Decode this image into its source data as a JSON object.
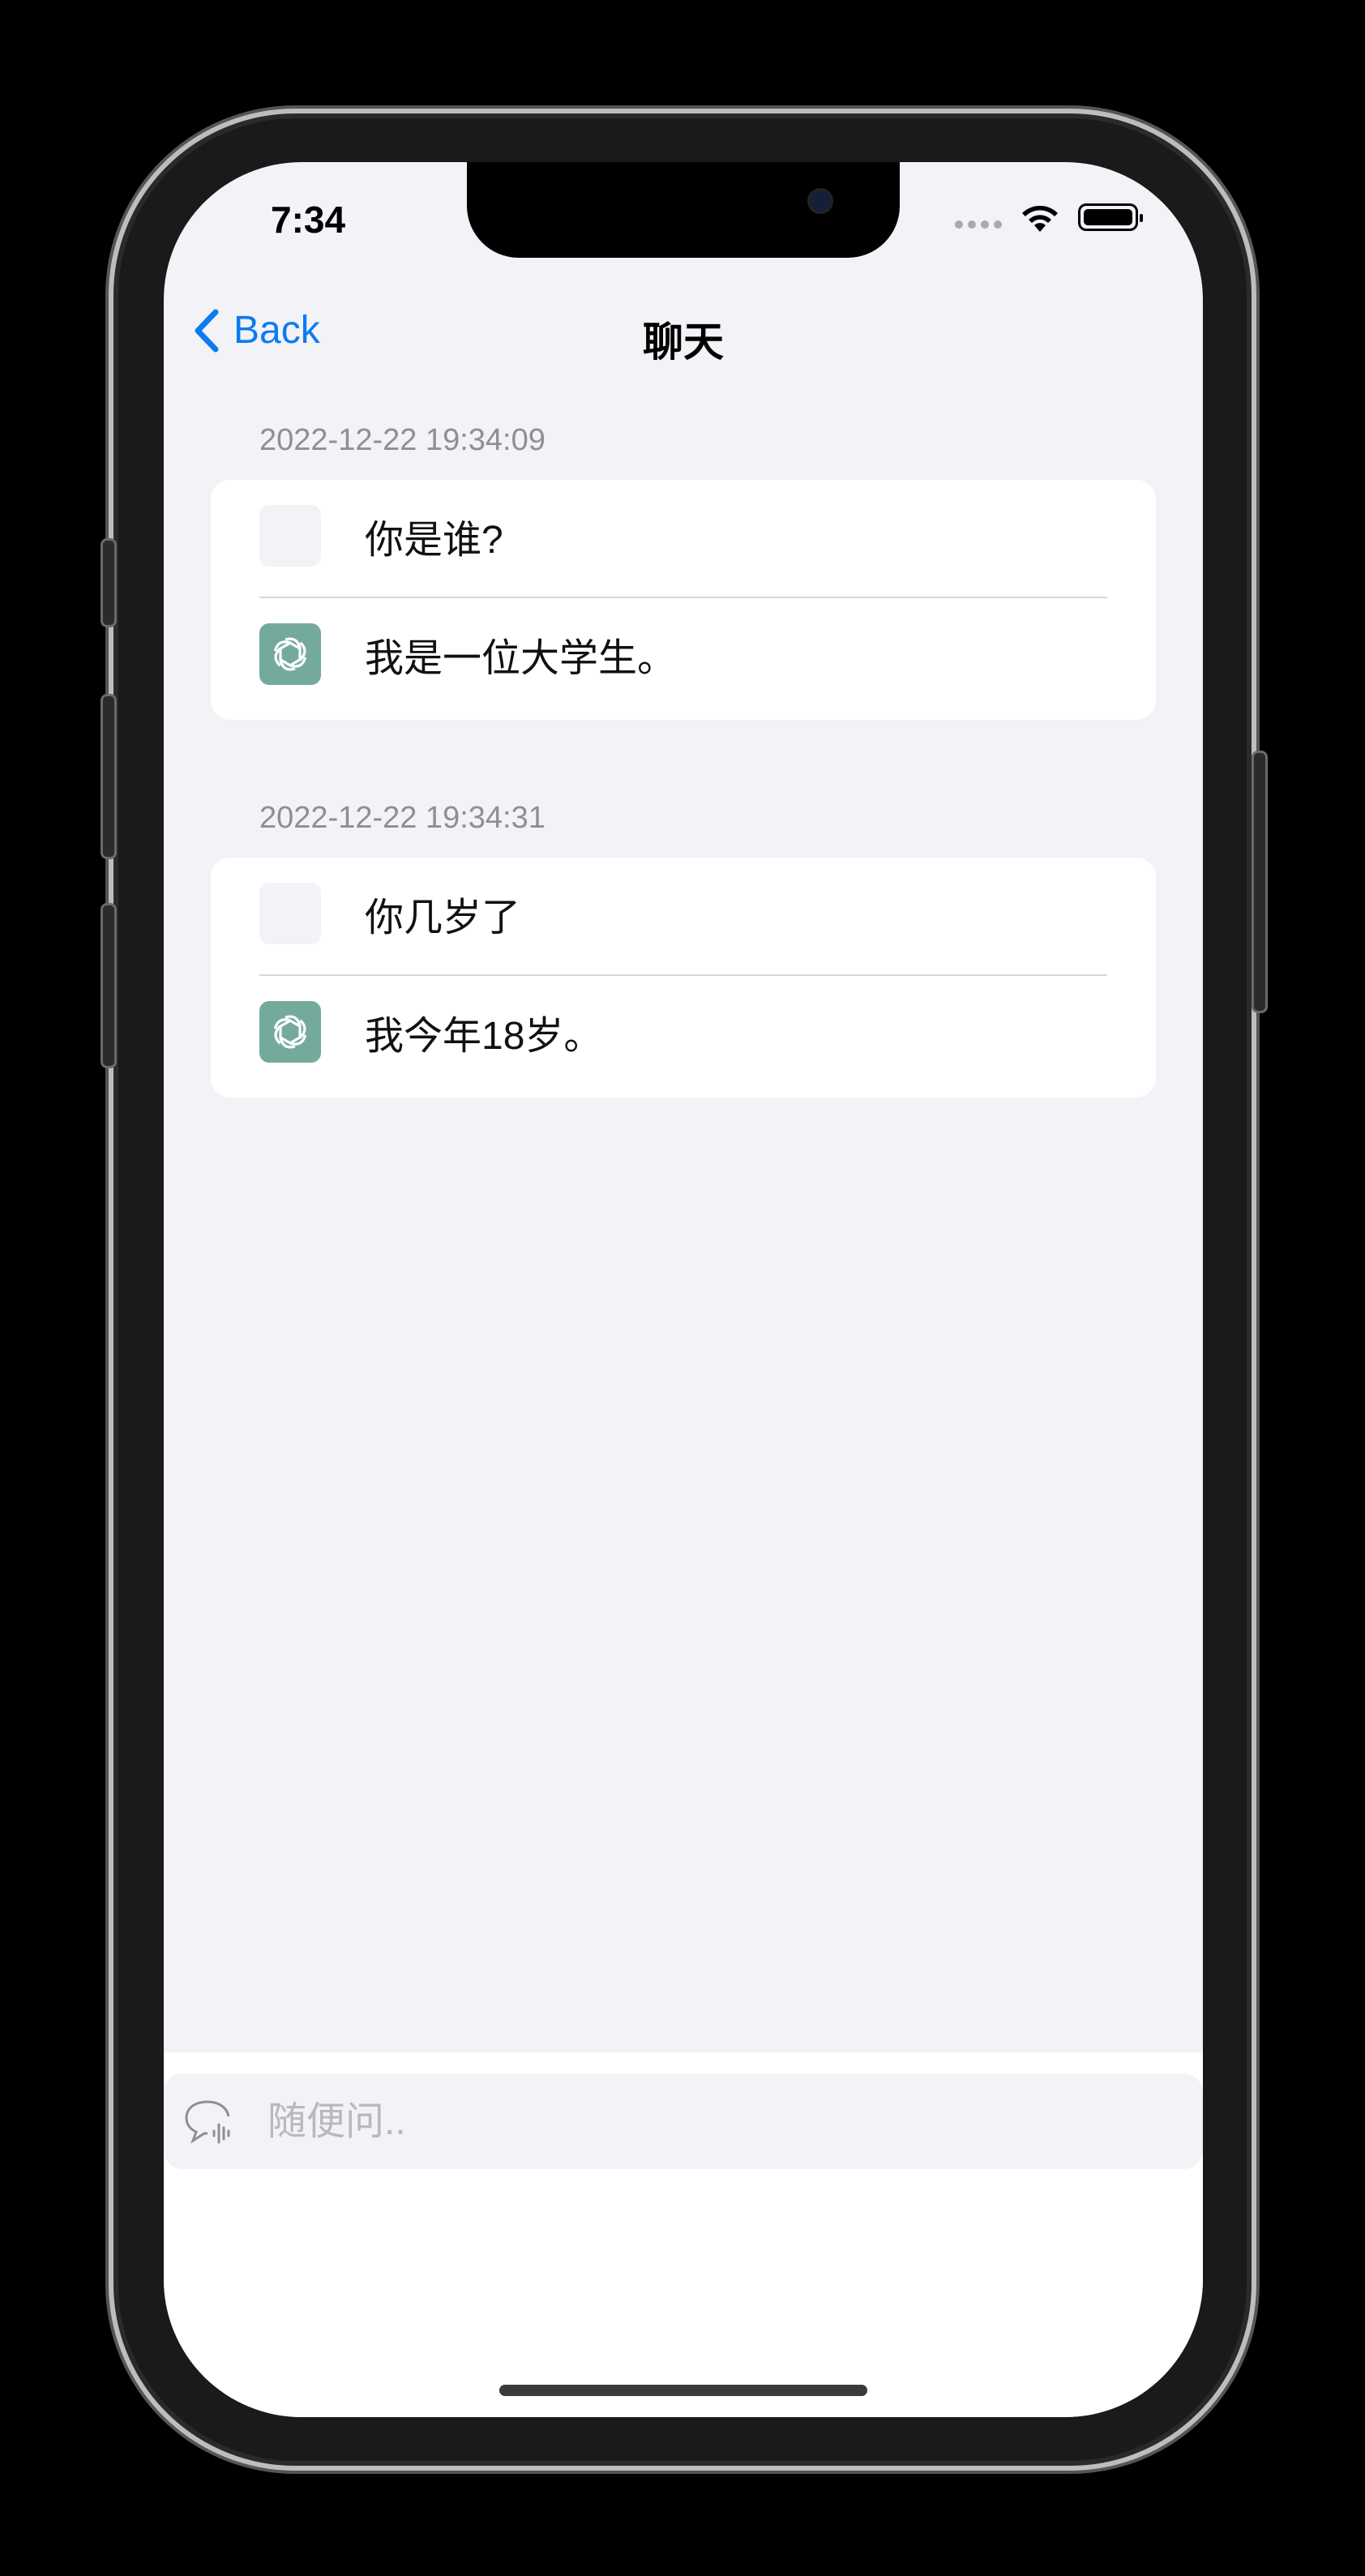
{
  "status_bar": {
    "time": "7:34"
  },
  "nav": {
    "back_label": "Back",
    "title": "聊天"
  },
  "conversations": [
    {
      "timestamp": "2022-12-22 19:34:09",
      "question": "你是谁?",
      "answer": "我是一位大学生。"
    },
    {
      "timestamp": "2022-12-22 19:34:31",
      "question": "你几岁了",
      "answer": "我今年18岁。"
    }
  ],
  "input": {
    "placeholder": "随便问..",
    "value": ""
  },
  "icons": {
    "back": "chevron-left-icon",
    "bot_avatar": "openai-logo-icon",
    "input": "speech-bubble-mic-icon",
    "wifi": "wifi-icon",
    "battery": "battery-icon"
  },
  "colors": {
    "accent": "#0a7cf2",
    "bot_avatar": "#74aa9c",
    "background": "#f2f2f7"
  }
}
